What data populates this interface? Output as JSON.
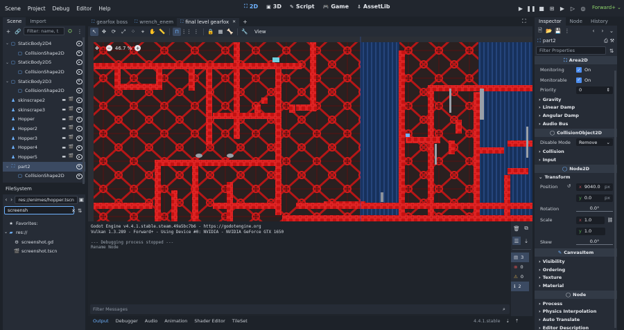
{
  "menu": [
    "Scene",
    "Project",
    "Debug",
    "Editor",
    "Help"
  ],
  "workspaces": [
    {
      "label": "2D",
      "icon": "2d-icon",
      "active": true
    },
    {
      "label": "3D",
      "icon": "3d-icon",
      "active": false
    },
    {
      "label": "Script",
      "icon": "script-icon",
      "active": false
    },
    {
      "label": "Game",
      "icon": "game-icon",
      "active": false
    },
    {
      "label": "AssetLib",
      "icon": "assetlib-icon",
      "active": false
    }
  ],
  "renderer": "Forward+",
  "scene_dock": {
    "tabs": [
      "Scene",
      "Import"
    ],
    "filter_placeholder": "Filter: name, t",
    "nodes": [
      {
        "label": "StaticBody2D4",
        "indent": 1,
        "icon": "staticbody-icon",
        "arrow": "⌄",
        "sel": false,
        "extra": false
      },
      {
        "label": "CollisionShape2D",
        "indent": 2,
        "icon": "collision-icon",
        "arrow": "",
        "sel": false,
        "extra": false
      },
      {
        "label": "StaticBody2D5",
        "indent": 1,
        "icon": "staticbody-icon",
        "arrow": "⌄",
        "sel": false,
        "extra": false
      },
      {
        "label": "CollisionShape2D",
        "indent": 2,
        "icon": "collision-icon",
        "arrow": "",
        "sel": false,
        "extra": false
      },
      {
        "label": "StaticBody2D3",
        "indent": 1,
        "icon": "staticbody-icon",
        "arrow": "⌄",
        "sel": false,
        "extra": false
      },
      {
        "label": "CollisionShape2D",
        "indent": 2,
        "icon": "collision-icon",
        "arrow": "",
        "sel": false,
        "extra": false
      },
      {
        "label": "skinscrape2",
        "indent": 1,
        "icon": "character-icon",
        "arrow": "",
        "sel": false,
        "extra": true
      },
      {
        "label": "skinscrape3",
        "indent": 1,
        "icon": "character-icon",
        "arrow": "",
        "sel": false,
        "extra": true
      },
      {
        "label": "Hopper",
        "indent": 1,
        "icon": "character-icon",
        "arrow": "",
        "sel": false,
        "extra": true
      },
      {
        "label": "Hopper2",
        "indent": 1,
        "icon": "character-icon",
        "arrow": "",
        "sel": false,
        "extra": true
      },
      {
        "label": "Hopper3",
        "indent": 1,
        "icon": "character-icon",
        "arrow": "",
        "sel": false,
        "extra": true
      },
      {
        "label": "Hopper4",
        "indent": 1,
        "icon": "character-icon",
        "arrow": "",
        "sel": false,
        "extra": true
      },
      {
        "label": "Hopper5",
        "indent": 1,
        "icon": "character-icon",
        "arrow": "",
        "sel": false,
        "extra": true
      },
      {
        "label": "part2",
        "indent": 1,
        "icon": "area2d-icon",
        "arrow": "⌄",
        "sel": true,
        "extra": false
      },
      {
        "label": "CollisionShape2D",
        "indent": 2,
        "icon": "collision-icon",
        "arrow": "",
        "sel": false,
        "extra": false
      }
    ]
  },
  "filesystem": {
    "title": "FileSystem",
    "path": "res://enimes/hopper.tscn",
    "search": "screensh",
    "items": [
      {
        "label": "Favorites:",
        "icon": "star-icon",
        "indent": 0
      },
      {
        "label": "res://",
        "icon": "folder-icon",
        "indent": 0
      },
      {
        "label": "screenshot.gd",
        "icon": "gdscript-icon",
        "indent": 1
      },
      {
        "label": "screenshot.tscn",
        "icon": "scene-file-icon",
        "indent": 1
      }
    ]
  },
  "editor_tabs": [
    {
      "label": "gearfox boss",
      "active": false
    },
    {
      "label": "wrench_enem",
      "active": false
    },
    {
      "label": "final level gearfox",
      "active": true
    }
  ],
  "toolbar_view": "View",
  "zoom": "46.7 %",
  "output": {
    "lines": [
      "Godot Engine v4.4.1.stable.steam.49a5bc7b6 - https://godotengine.org",
      "Vulkan 1.3.289 - Forward+ - Using Device #0: NVIDIA - NVIDIA GeForce GTX 1650",
      "",
      "--- Debugging process stopped ---",
      "Rename Node"
    ],
    "filter_placeholder": "Filter Messages",
    "counts": [
      "3",
      "0",
      "0",
      "2"
    ]
  },
  "bottom_tabs": [
    {
      "label": "Output",
      "active": true
    },
    {
      "label": "Debugger",
      "active": false
    },
    {
      "label": "Audio",
      "active": false
    },
    {
      "label": "Animation",
      "active": false
    },
    {
      "label": "Shader Editor",
      "active": false
    },
    {
      "label": "TileSet",
      "active": false
    }
  ],
  "version": "4.4.1.stable",
  "inspector": {
    "tabs": [
      "Inspector",
      "Node",
      "History"
    ],
    "node_name": "part2",
    "filter_placeholder": "Filter Properties",
    "area_title": "Area2D",
    "monitoring_label": "Monitoring",
    "monitoring_value": "On",
    "monitorable_label": "Monitorable",
    "monitorable_value": "On",
    "priority_label": "Priority",
    "priority_value": "0",
    "area_groups": [
      "Gravity",
      "Linear Damp",
      "Angular Damp",
      "Audio Bus"
    ],
    "collision_title": "CollisionObject2D",
    "disable_mode_label": "Disable Mode",
    "disable_mode_value": "Remove",
    "collision_groups": [
      "Collision",
      "Input"
    ],
    "node2d_title": "Node2D",
    "transform_label": "Transform",
    "position_label": "Position",
    "pos_x": "9040.0",
    "pos_y": "0.0",
    "unit": "px",
    "rotation_label": "Rotation",
    "rotation_value": "0.0",
    "degree": "°",
    "scale_label": "Scale",
    "scale_x": "1.0",
    "scale_y": "1.0",
    "skew_label": "Skew",
    "skew_value": "0.0",
    "canvas_title": "CanvasItem",
    "canvas_groups": [
      "Visibility",
      "Ordering",
      "Texture",
      "Material"
    ],
    "node_title": "Node",
    "node_groups": [
      "Process",
      "Physics Interpolation",
      "Auto Translate",
      "Editor Description"
    ],
    "axis_x": "x",
    "axis_y": "y"
  },
  "colors": {
    "accent": "#6fb3ff",
    "tile_red": "#c41212",
    "tile_dark": "#2a1a1a",
    "water": "#17315c",
    "renderer": "#8ed46b"
  }
}
